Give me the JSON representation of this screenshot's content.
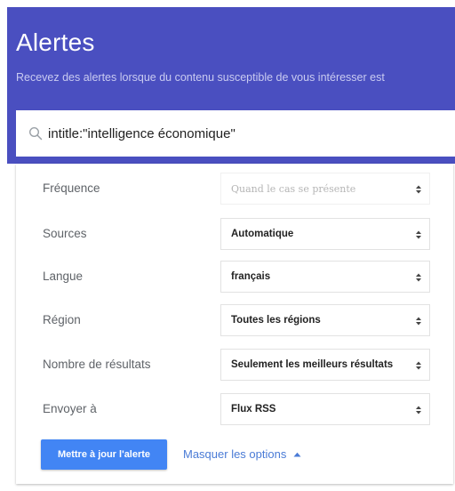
{
  "header": {
    "title": "Alertes",
    "subtitle": "Recevez des alertes lorsque du contenu susceptible de vous intéresser est"
  },
  "search": {
    "value": "intitle:\"intelligence économique\"",
    "icon": "search-icon"
  },
  "options": [
    {
      "label": "Fréquence",
      "value": "Quand le cas se présente",
      "disabled": true
    },
    {
      "label": "Sources",
      "value": "Automatique"
    },
    {
      "label": "Langue",
      "value": "français"
    },
    {
      "label": "Région",
      "value": "Toutes les régions"
    },
    {
      "label": "Nombre de résultats",
      "value": "Seulement les meilleurs résultats"
    },
    {
      "label": "Envoyer à",
      "value": "Flux RSS"
    }
  ],
  "actions": {
    "update_label": "Mettre à jour l'alerte",
    "toggle_label": "Masquer les options"
  },
  "colors": {
    "header_bg": "#4a4fc0",
    "primary_button": "#4285f4",
    "link": "#4a7bd6"
  }
}
